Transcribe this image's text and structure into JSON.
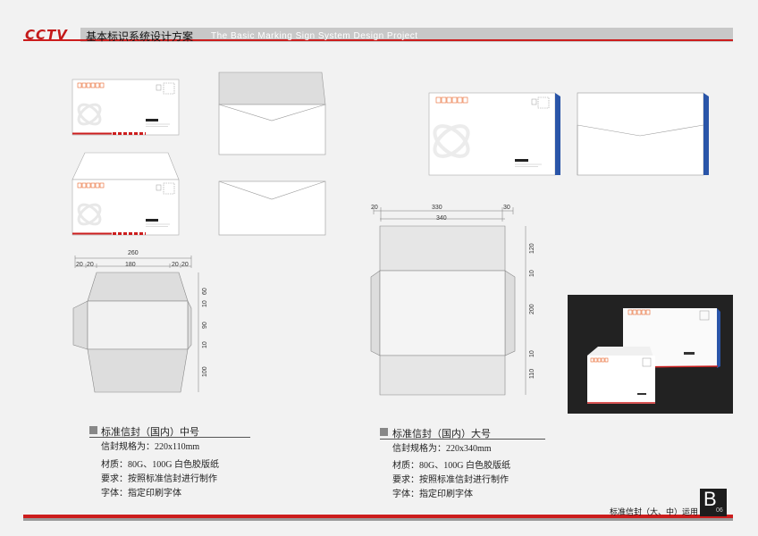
{
  "header": {
    "logo": "CCTV",
    "title_cn": "基本标识系统设计方案",
    "title_en": "The Basic Marking Sign System Design Project"
  },
  "footer": {
    "label": "标准信封（大、中）运用",
    "section_letter": "B",
    "page_number": "06"
  },
  "medium": {
    "heading": "标准信封（国内）中号",
    "size_label": "信封规格为：220x110mm",
    "material": "材质：80G、100G 白色胶版纸",
    "requirement": "要求：按照标准信封进行制作",
    "font": "字体：指定印刷字体",
    "dims_top": {
      "total": "260",
      "a": "20",
      "b": "20",
      "c": "180",
      "d": "20",
      "e": "20"
    },
    "dims_side": {
      "a": "60",
      "b": "10",
      "c": "90",
      "d": "10",
      "e": "100"
    }
  },
  "large": {
    "heading": "标准信封（国内）大号",
    "size_label": "信封规格为：220x340mm",
    "material": "材质：80G、100G 白色胶版纸",
    "requirement": "要求：按照标准信封进行制作",
    "font": "字体：指定印刷字体",
    "dims_top": {
      "left": "20",
      "mid": "330",
      "right": "30",
      "total": "340"
    },
    "dims_side": {
      "a": "120",
      "b": "10",
      "c": "200",
      "d": "10",
      "e": "110"
    }
  },
  "envelope_logo": "CCTV",
  "colors": {
    "accent_red": "#cc1d1d",
    "accent_blue": "#2a55a8",
    "stamp_orange": "#e8642a"
  }
}
